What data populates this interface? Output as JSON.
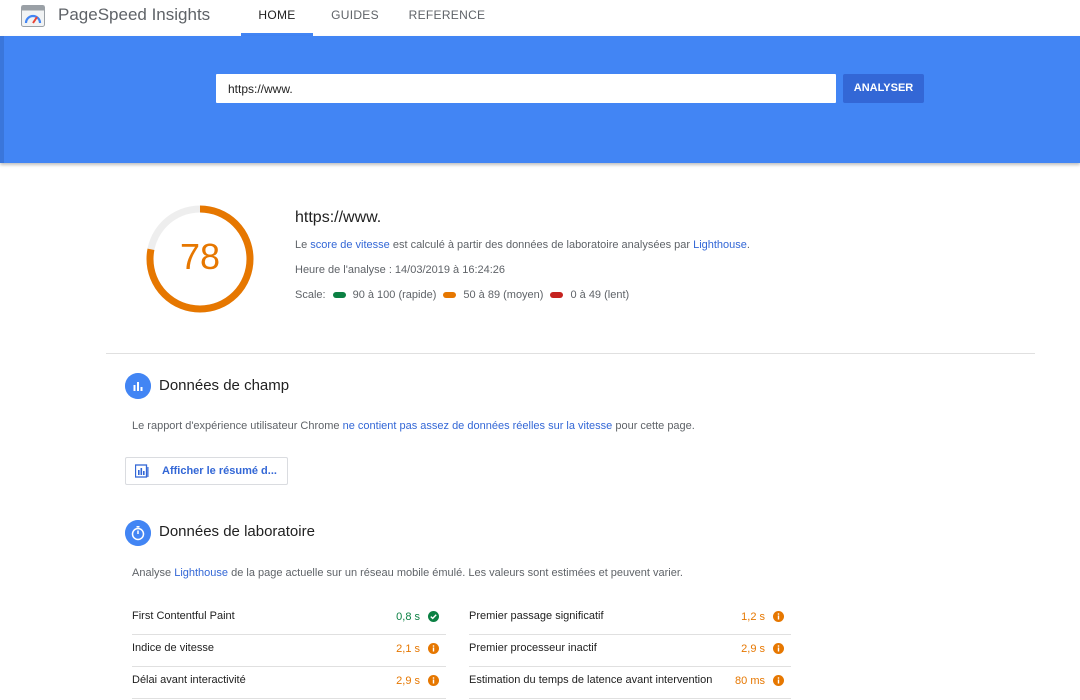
{
  "header": {
    "app_title": "PageSpeed Insights",
    "tabs": [
      {
        "label": "HOME",
        "active": true
      },
      {
        "label": "GUIDES",
        "active": false
      },
      {
        "label": "REFERENCE",
        "active": false
      }
    ]
  },
  "search": {
    "url_value": "https://www.",
    "analyze_label": "ANALYSER"
  },
  "score": {
    "value": "78",
    "fraction": 0.78,
    "url": "https://www.",
    "desc_prefix": "Le ",
    "desc_link1": "score de vitesse",
    "desc_middle": " est calculé à partir des données de laboratoire analysées par ",
    "desc_link2": "Lighthouse",
    "desc_suffix": ".",
    "analysis_time": "Heure de l'analyse : 14/03/2019 à 16:24:26",
    "scale_label": "Scale:",
    "scale": [
      {
        "label": "90 à 100 (rapide)",
        "color": "#0b8043"
      },
      {
        "label": "50 à 89 (moyen)",
        "color": "#e67700"
      },
      {
        "label": "0 à 49 (lent)",
        "color": "#c5221f"
      }
    ]
  },
  "field": {
    "title": "Données de champ",
    "text_prefix": "Le rapport d'expérience utilisateur Chrome ",
    "text_link": "ne contient pas assez de données réelles sur la vitesse",
    "text_suffix": " pour cette page.",
    "summary_button": "Afficher le résumé d..."
  },
  "lab": {
    "title": "Données de laboratoire",
    "text_prefix": "Analyse ",
    "text_link": "Lighthouse",
    "text_suffix": " de la page actuelle sur un réseau mobile émulé. Les valeurs sont estimées et peuvent varier.",
    "metrics_left": [
      {
        "label": "First Contentful Paint",
        "value": "0,8 s",
        "status": "fast"
      },
      {
        "label": "Indice de vitesse",
        "value": "2,1 s",
        "status": "average"
      },
      {
        "label": "Délai avant interactivité",
        "value": "2,9 s",
        "status": "average"
      }
    ],
    "metrics_right": [
      {
        "label": "Premier passage significatif",
        "value": "1,2 s",
        "status": "average"
      },
      {
        "label": "Premier processeur inactif",
        "value": "2,9 s",
        "status": "average"
      },
      {
        "label": "Estimation du temps de latence avant intervention",
        "value": "80 ms",
        "status": "average"
      }
    ]
  },
  "colors": {
    "brand_blue": "#4285f4",
    "button_blue": "#3367d6",
    "fast_green": "#0b8043",
    "average_orange": "#e67700",
    "slow_red": "#c5221f"
  }
}
